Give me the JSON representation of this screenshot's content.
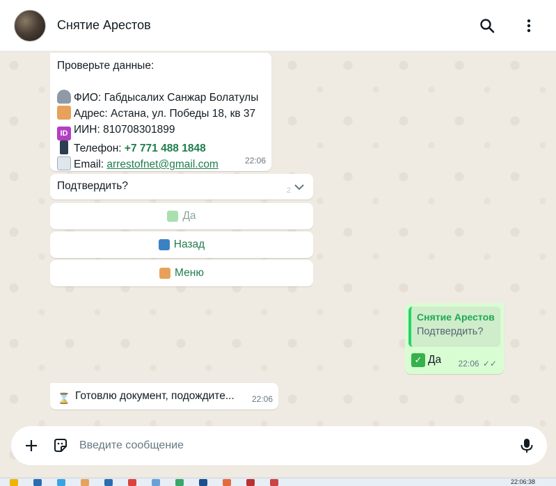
{
  "header": {
    "title": "Снятие Арестов",
    "icons": [
      "search-icon",
      "more-vertical-icon"
    ]
  },
  "info_message": {
    "intro": "Проверьте данные:",
    "fio_label": "ФИО:",
    "fio": "Габдысалих Санжар Болатулы",
    "address_label": "Адрес:",
    "address": "Астана, ул. Победы 18, кв 37",
    "iin_label": "ИИН:",
    "iin": "810708301899",
    "phone_label": "Телефон:",
    "phone": "+7 771 488 1848",
    "email_label": "Email:",
    "email": "arrestofnet@gmail.com",
    "time": "22:06"
  },
  "confirm_message": {
    "text": "Подтвердить?",
    "faded": "2"
  },
  "buttons": {
    "yes": "Да",
    "back": "Назад",
    "menu": "Меню"
  },
  "outgoing": {
    "quote_name": "Снятие Арестов",
    "quote_text": "Подтвердить?",
    "reply": "Да",
    "time": "22:06"
  },
  "wait_message": {
    "text": "Готовлю документ, подождите...",
    "time": "22:06"
  },
  "composer": {
    "placeholder": "Введите сообщение"
  },
  "taskbar": {
    "clock": "22:06:38"
  },
  "colors": {
    "accent_green": "#1f7d4d",
    "chat_bg": "#efeae2",
    "outgoing_bg": "#d9fdd3"
  }
}
